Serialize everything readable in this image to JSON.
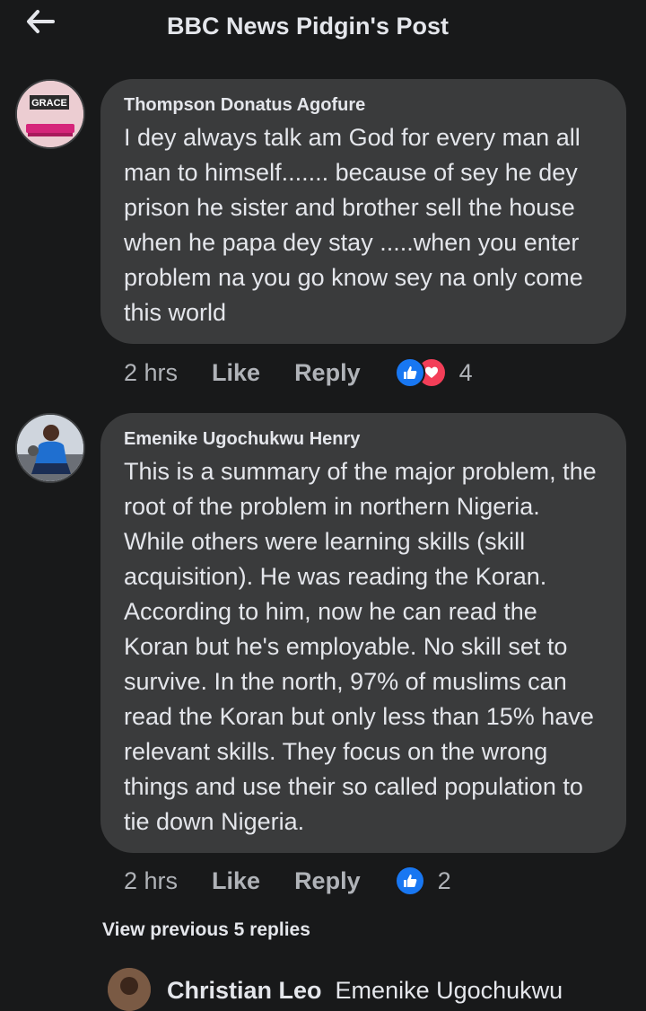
{
  "header": {
    "title": "BBC News Pidgin's Post",
    "back_icon": "arrow-left-icon"
  },
  "comments": [
    {
      "author": "Thompson Donatus Agofure",
      "avatar_text": "GRACE",
      "text": "I dey always talk am God for every man all man to himself....... because of sey he dey prison he sister and brother sell the house when he papa dey stay .....when you enter problem na you go know sey na only come this world",
      "time": "2 hrs",
      "like_label": "Like",
      "reply_label": "Reply",
      "reactions": [
        "like",
        "love"
      ],
      "reaction_count": "4"
    },
    {
      "author": "Emenike Ugochukwu Henry",
      "text": "This is a summary of the major problem, the root of the problem in northern Nigeria. While others were learning skills (skill acquisition). He was reading the Koran. According to him, now he can read the Koran but he's employable. No skill set to survive.  In the north, 97% of muslims can read the Koran but only less than 15% have relevant skills. They focus on the wrong things and use their so called population to tie down Nigeria.",
      "time": "2 hrs",
      "like_label": "Like",
      "reply_label": "Reply",
      "reactions": [
        "like"
      ],
      "reaction_count": "2"
    }
  ],
  "view_previous": "View previous 5 replies",
  "reply_preview": {
    "author": "Christian Leo",
    "mention": "Emenike Ugochukwu"
  },
  "colors": {
    "background": "#18191a",
    "bubble": "#3a3b3c",
    "like_blue": "#1877f2",
    "love_red": "#f33e58"
  }
}
